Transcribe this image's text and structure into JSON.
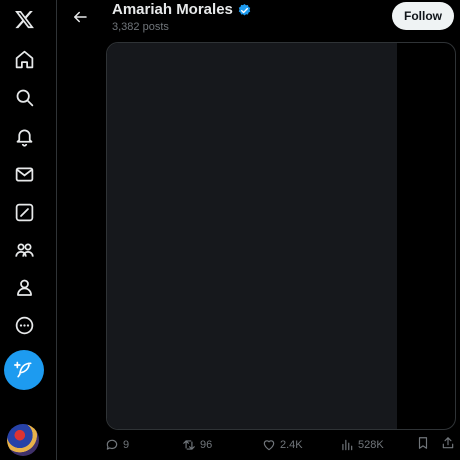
{
  "sidebar": {
    "items": [
      {
        "icon": "x-logo-icon"
      },
      {
        "icon": "home-icon"
      },
      {
        "icon": "search-icon"
      },
      {
        "icon": "bell-icon"
      },
      {
        "icon": "mail-icon"
      },
      {
        "icon": "grok-icon"
      },
      {
        "icon": "communities-icon"
      },
      {
        "icon": "profile-icon"
      },
      {
        "icon": "more-icon"
      }
    ],
    "compose_icon": "feather-plus-icon"
  },
  "header": {
    "name": "Amariah Morales",
    "post_count": "3,382 posts",
    "follow_label": "Follow",
    "verified_color": "#1d9bf0"
  },
  "actions": {
    "replies": "9",
    "reposts": "96",
    "likes": "2.4K",
    "views": "528K"
  },
  "colors": {
    "accent": "#1d9bf0",
    "muted": "#71767b",
    "border": "#2f3336"
  }
}
